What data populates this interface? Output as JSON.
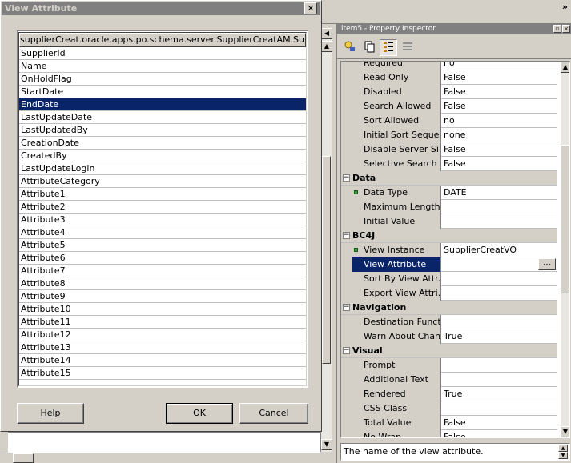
{
  "dialog": {
    "title": "View Attribute",
    "close_glyph": "✕",
    "list_header": "supplierCreat.oracle.apps.po.schema.server.SupplierCreatAM.Supplier...",
    "items": [
      "SupplierId",
      "Name",
      "OnHoldFlag",
      "StartDate",
      "EndDate",
      "LastUpdateDate",
      "LastUpdatedBy",
      "CreationDate",
      "CreatedBy",
      "LastUpdateLogin",
      "AttributeCategory",
      "Attribute1",
      "Attribute2",
      "Attribute3",
      "Attribute4",
      "Attribute5",
      "Attribute6",
      "Attribute7",
      "Attribute8",
      "Attribute9",
      "Attribute10",
      "Attribute11",
      "Attribute12",
      "Attribute13",
      "Attribute14",
      "Attribute15"
    ],
    "selected_item": "EndDate",
    "help_label": "Help",
    "ok_label": "OK",
    "cancel_label": "Cancel"
  },
  "top_right": {
    "chevron": "»"
  },
  "inspector": {
    "title": "item5 - Property Inspector",
    "status_text": "The name of the view attribute.",
    "rows": [
      {
        "kind": "prop",
        "name": "Required",
        "value": "no"
      },
      {
        "kind": "prop",
        "name": "Read Only",
        "value": "False"
      },
      {
        "kind": "prop",
        "name": "Disabled",
        "value": "False"
      },
      {
        "kind": "prop",
        "name": "Search Allowed",
        "value": "False"
      },
      {
        "kind": "prop",
        "name": "Sort Allowed",
        "value": "no"
      },
      {
        "kind": "prop",
        "name": "Initial Sort Sequen...",
        "value": "none"
      },
      {
        "kind": "prop",
        "name": "Disable Server Si...",
        "value": "False"
      },
      {
        "kind": "prop",
        "name": "Selective Search ...",
        "value": "False"
      },
      {
        "kind": "group",
        "name": "Data"
      },
      {
        "kind": "prop",
        "name": "Data Type",
        "value": "DATE",
        "required": true
      },
      {
        "kind": "prop",
        "name": "Maximum Length",
        "value": ""
      },
      {
        "kind": "prop",
        "name": "Initial Value",
        "value": ""
      },
      {
        "kind": "group",
        "name": "BC4J"
      },
      {
        "kind": "prop",
        "name": "View Instance",
        "value": "SupplierCreatVO",
        "required": true
      },
      {
        "kind": "prop",
        "name": "View Attribute",
        "value": "",
        "selected": true,
        "ellipsis": "..."
      },
      {
        "kind": "prop",
        "name": "Sort By View Attr...",
        "value": ""
      },
      {
        "kind": "prop",
        "name": "Export View Attri...",
        "value": ""
      },
      {
        "kind": "group",
        "name": "Navigation"
      },
      {
        "kind": "prop",
        "name": "Destination Functi...",
        "value": ""
      },
      {
        "kind": "prop",
        "name": "Warn About Chan...",
        "value": "True"
      },
      {
        "kind": "group",
        "name": "Visual"
      },
      {
        "kind": "prop",
        "name": "Prompt",
        "value": ""
      },
      {
        "kind": "prop",
        "name": "Additional Text",
        "value": ""
      },
      {
        "kind": "prop",
        "name": "Rendered",
        "value": "True"
      },
      {
        "kind": "prop",
        "name": "CSS Class",
        "value": ""
      },
      {
        "kind": "prop",
        "name": "Total Value",
        "value": "False"
      },
      {
        "kind": "prop",
        "name": "No Wrap",
        "value": "False"
      }
    ]
  }
}
